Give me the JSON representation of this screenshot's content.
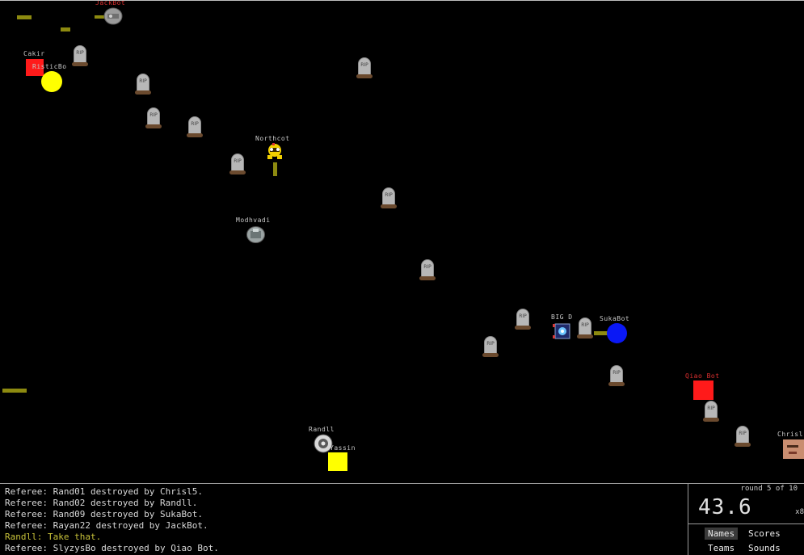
{
  "arena": {
    "tombstone_label": "RIP",
    "bots": [
      {
        "name": "JackBot",
        "name_color": "red"
      },
      {
        "name": "Cakir"
      },
      {
        "name": "RisticBo"
      },
      {
        "name": "Northcot"
      },
      {
        "name": "Modhvadi"
      },
      {
        "name": "BIG D"
      },
      {
        "name": "SukaBot"
      },
      {
        "name": "Qiao Bot",
        "name_color": "red"
      },
      {
        "name": "Randll"
      },
      {
        "name": "Yassin"
      },
      {
        "name": "Chrisl"
      }
    ],
    "colors": {
      "red_bot": "#ff1a1a",
      "yellow_bot": "#ffff00",
      "blue_bot": "#0a18f5",
      "bullet": "#8d8a10",
      "tomb": "#b7b7b7"
    }
  },
  "log": [
    {
      "text": "Referee: Rand01 destroyed by Chrisl5."
    },
    {
      "text": "Referee: Rand02 destroyed by Randll."
    },
    {
      "text": "Referee: Rand09 destroyed by SukaBot."
    },
    {
      "text": "Referee: Rayan22 destroyed by JackBot."
    },
    {
      "text": "Randll: Take that.",
      "chat": true
    },
    {
      "text": "Referee: SlyzysBo destroyed by Qiao Bot."
    }
  ],
  "status": {
    "round": "round 5 of 10",
    "timer": "43.6",
    "speed": "x8"
  },
  "tabs": {
    "names": "Names",
    "scores": "Scores",
    "teams": "Teams",
    "sounds": "Sounds"
  }
}
